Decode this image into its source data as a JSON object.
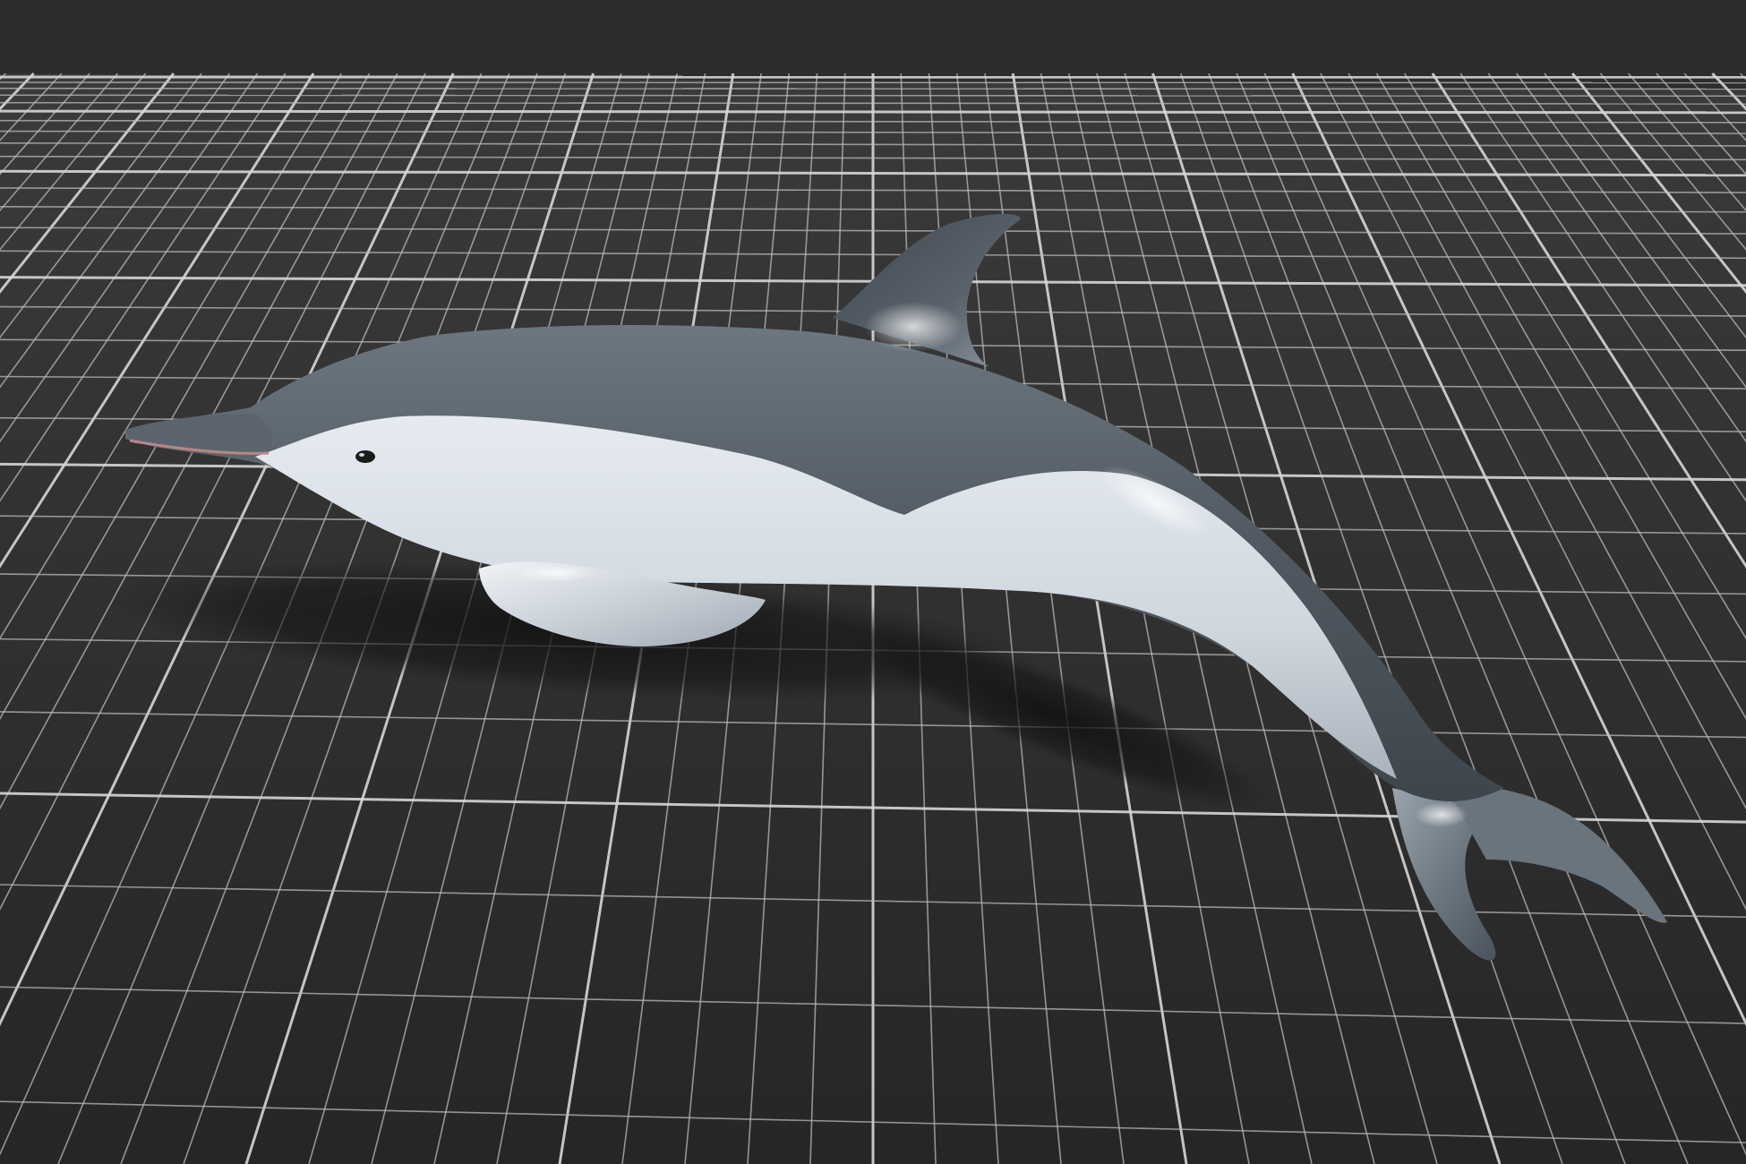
{
  "viewport": {
    "background_color": "#2d2d2d",
    "floor_color": "#303030",
    "grid_line_color": "#b9b9b9",
    "grid_major_line_color": "#d6d6d6",
    "shadow_color": "#141414"
  },
  "model": {
    "subject": "dolphin-3d-model",
    "dorsal_color": "#4f5860",
    "ventral_color": "#d7dde4",
    "fin_color": "#5a636b",
    "eye_color": "#1c1c1c",
    "mouth_color": "#b88585"
  }
}
